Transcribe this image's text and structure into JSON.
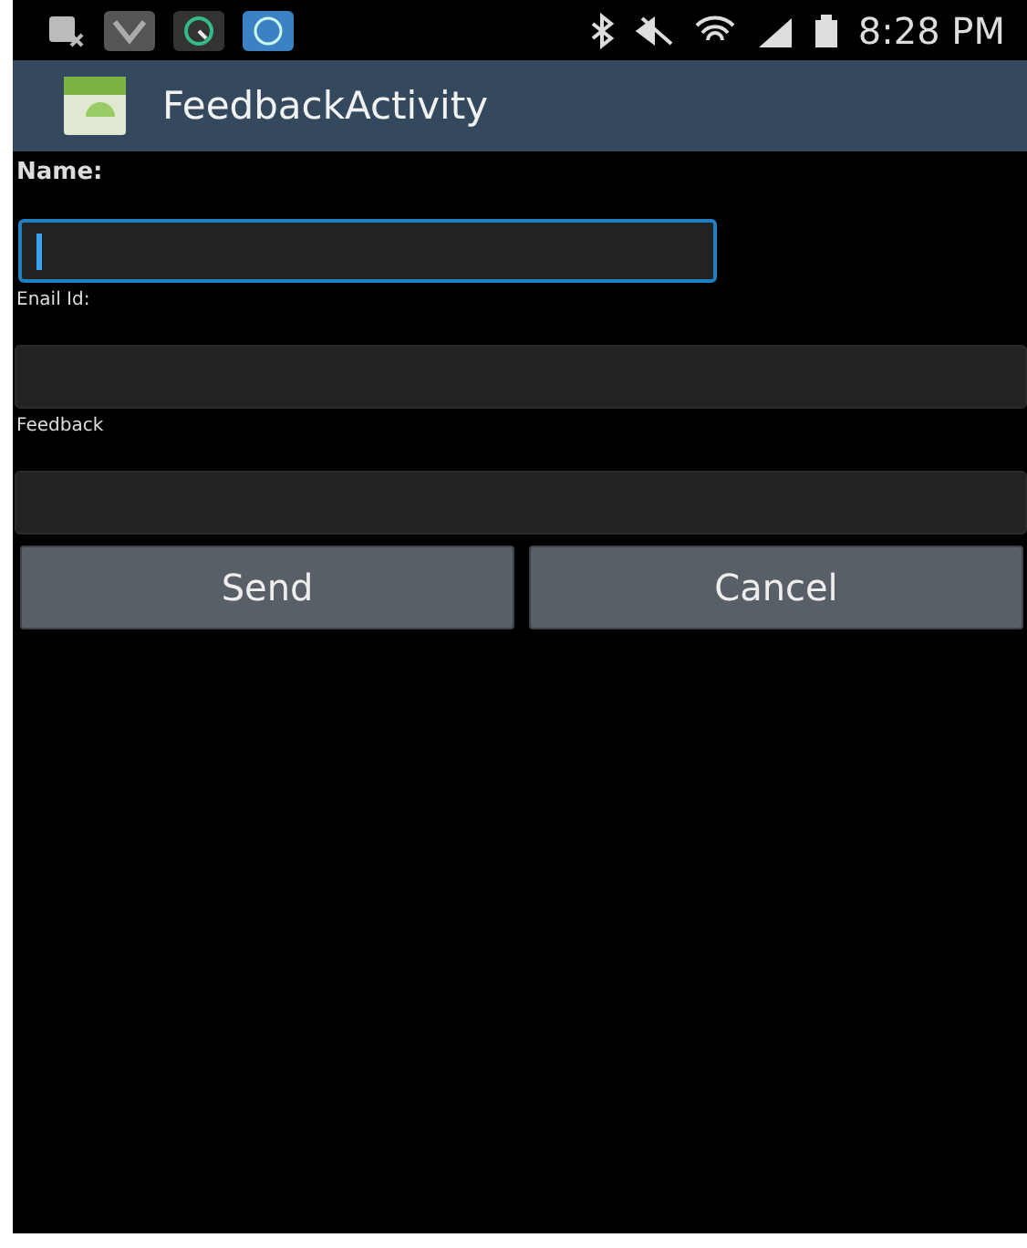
{
  "status_bar": {
    "time": "8:28 PM"
  },
  "app_bar": {
    "title": "FeedbackActivity"
  },
  "fields": [
    {
      "label": "Name:",
      "kind": "short",
      "focused": true
    },
    {
      "label": "Enail Id:",
      "kind": "wide",
      "focused": false
    },
    {
      "label": "Feedback",
      "kind": "wide",
      "focused": false
    }
  ],
  "buttons": [
    "Send",
    "Cancel"
  ]
}
